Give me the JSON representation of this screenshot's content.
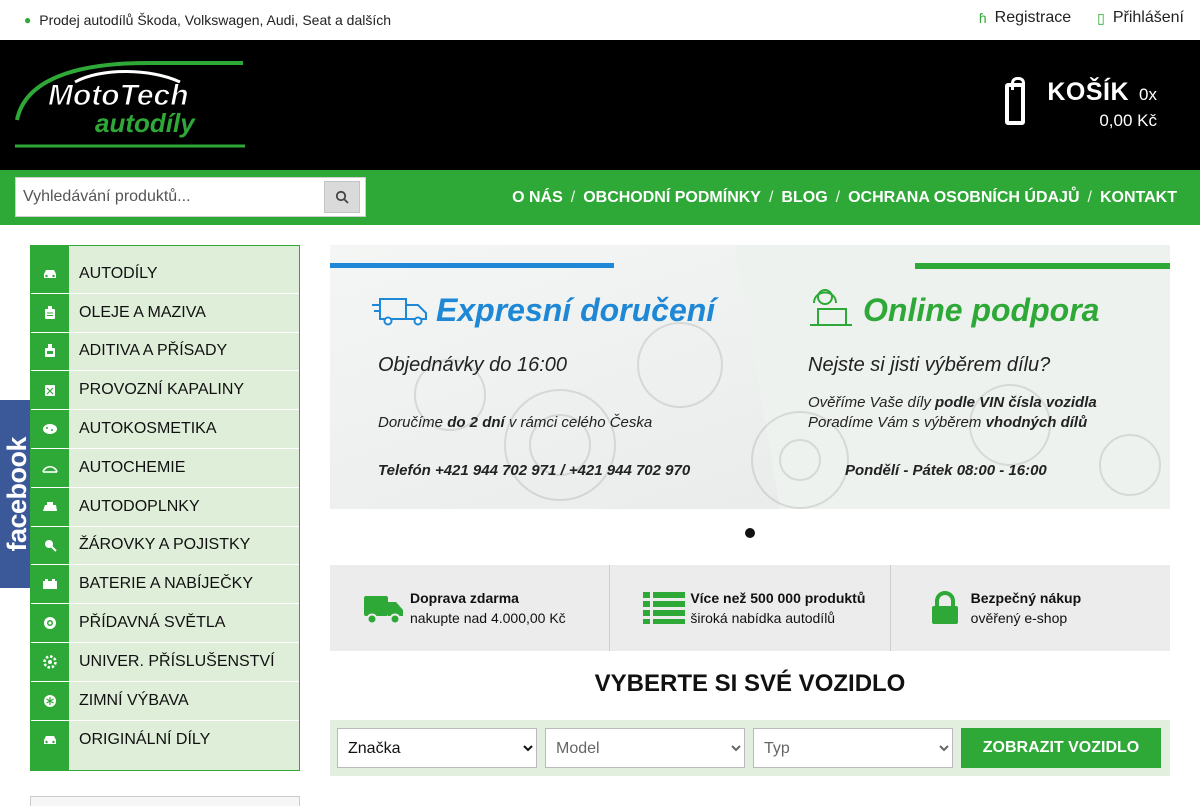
{
  "topbar": {
    "tagline": "Prodej autodílů Škoda, Volkswagen, Audi, Seat a dalších",
    "register": "Registrace",
    "login": "Přihlášení"
  },
  "logo": {
    "line1": "MotoTech",
    "line2": "autodíly"
  },
  "cart": {
    "title": "KOŠÍK",
    "count": "0x",
    "price": "0,00 Kč"
  },
  "search": {
    "placeholder": "Vyhledávání produktů..."
  },
  "nav": [
    "O NÁS",
    "OBCHODNÍ PODMÍNKY",
    "BLOG",
    "OCHRANA OSOBNÍCH ÚDAJŮ",
    "KONTAKT"
  ],
  "categories": [
    {
      "label": "Autodíly",
      "icon": "car-icon"
    },
    {
      "label": "Oleje a maziva",
      "icon": "oil-can-icon"
    },
    {
      "label": "Aditiva a přísady",
      "icon": "bottle-icon"
    },
    {
      "label": "Provozní kapaliny",
      "icon": "canister-icon"
    },
    {
      "label": "Autokosmetika",
      "icon": "sponge-icon"
    },
    {
      "label": "Autochemie",
      "icon": "spray-icon"
    },
    {
      "label": "Autodoplnky",
      "icon": "accessory-icon"
    },
    {
      "label": "Žárovky a pojistky",
      "icon": "bulb-icon"
    },
    {
      "label": "Baterie a nabíječky",
      "icon": "battery-icon"
    },
    {
      "label": "Přídavná světla",
      "icon": "light-icon"
    },
    {
      "label": "Univer. příslušenství",
      "icon": "gear-icon"
    },
    {
      "label": "Zimní výbava",
      "icon": "snowflake-icon"
    },
    {
      "label": "Originální díly",
      "icon": "car-icon"
    }
  ],
  "facebook": "facebook",
  "banner": {
    "left": {
      "heading": "Expresní doručení",
      "line1": "Objednávky do 16:00",
      "line2_a": "Doručíme ",
      "line2_b": "do 2 dní",
      "line2_c": " v rámci celého Česka",
      "phone": "Telefón  +421 944 702 971  /  +421 944 702 970"
    },
    "right": {
      "heading": "Online podpora",
      "line1": "Nejste si jisti výběrem dílu?",
      "line2_a": "Ověříme Vaše díly ",
      "line2_b": "podle VIN čísla vozidla",
      "line3_a": "Poradíme Vám s výběrem ",
      "line3_b": "vhodných dílů",
      "hours": "Pondělí - Pátek  08:00 - 16:00"
    }
  },
  "benefits": [
    {
      "title": "Doprava zdarma",
      "sub": "nakupte nad 4.000,00 Kč",
      "icon": "truck-icon"
    },
    {
      "title": "Více než 500 000 produktů",
      "sub": "široká nabídka autodílů",
      "icon": "list-icon"
    },
    {
      "title": "Bezpečný nákup",
      "sub": "ověřený e-shop",
      "icon": "lock-icon"
    }
  ],
  "vehicle": {
    "title": "VYBERTE SI SVÉ VOZIDLO",
    "brand": "Značka",
    "model": "Model",
    "type": "Typ",
    "button": "ZOBRAZIT VOZIDLO"
  },
  "colors": {
    "green": "#2ea836",
    "black": "#000000",
    "facebook": "#3b5998"
  }
}
